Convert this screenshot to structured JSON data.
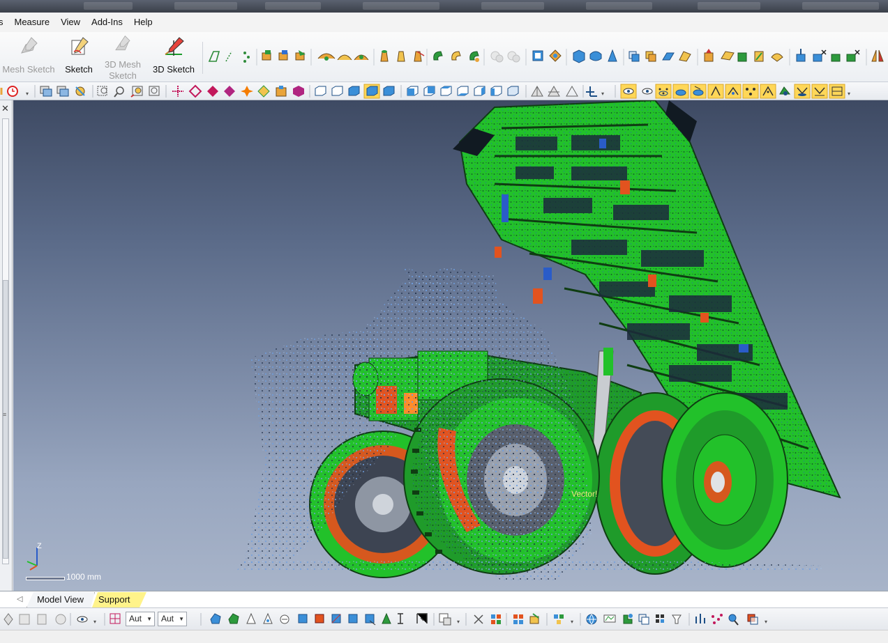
{
  "menu": {
    "items": [
      "s",
      "Measure",
      "View",
      "Add-Ins",
      "Help"
    ]
  },
  "ribbon": {
    "buttons": [
      {
        "label": "Mesh Sketch",
        "enabled": false,
        "icon": "mesh-sketch-icon"
      },
      {
        "label": "Sketch",
        "enabled": true,
        "icon": "sketch-icon"
      },
      {
        "label_line1": "3D Mesh",
        "label_line2": "Sketch",
        "enabled": false,
        "icon": "3d-mesh-sketch-icon"
      },
      {
        "label": "3D Sketch",
        "enabled": true,
        "icon": "3d-sketch-icon"
      }
    ]
  },
  "viewport": {
    "annotation": "Vector!",
    "scale_label": "1000 mm",
    "axis_label": "Z",
    "background_top": "#3e4a63",
    "background_bottom": "#a8b4c9",
    "mesh_color": "#22c12a",
    "deviation_colors": [
      "#e2531f",
      "#2a5cc8",
      "#1e2633"
    ]
  },
  "tabs": {
    "model_view": "Model View",
    "support": "Support"
  },
  "bottom_toolbar": {
    "combo1": "Aut",
    "combo2": "Aut"
  },
  "colors": {
    "accent_highlight": "#ffd758",
    "support_tab": "#fff38a"
  }
}
